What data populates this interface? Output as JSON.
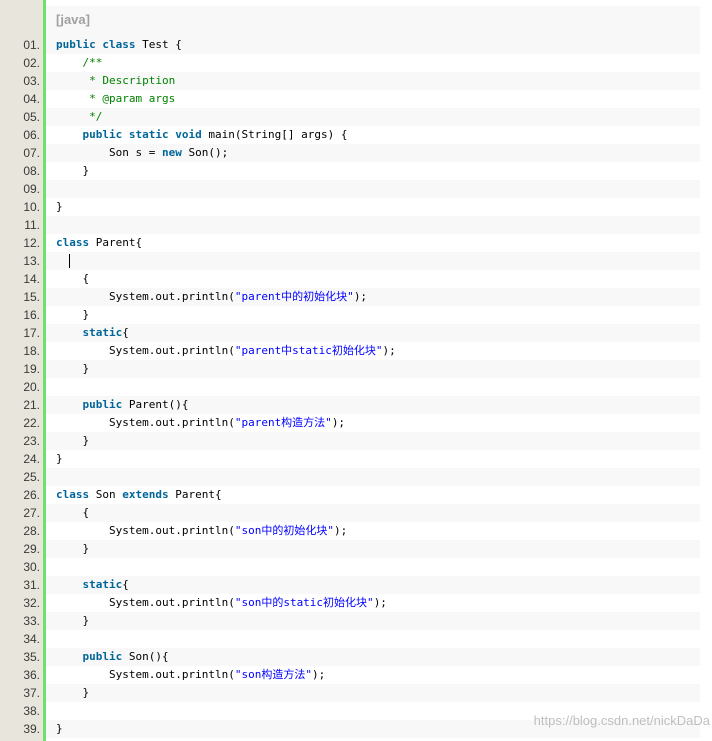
{
  "header": {
    "language_label": "[java]"
  },
  "watermark": "https://blog.csdn.net/nickDaDa",
  "colors": {
    "gutter": "#e8e5dc",
    "accent_bar": "#6ce26c",
    "keyword": "#006699",
    "comment": "#008200",
    "string": "#0000ff"
  },
  "lines": [
    {
      "n": "01.",
      "indent": "",
      "tokens": [
        [
          "kw",
          "public"
        ],
        [
          "t",
          " "
        ],
        [
          "kw",
          "class"
        ],
        [
          "t",
          " Test {"
        ]
      ]
    },
    {
      "n": "02.",
      "indent": "    ",
      "tokens": [
        [
          "cm",
          "/**"
        ]
      ]
    },
    {
      "n": "03.",
      "indent": "     ",
      "tokens": [
        [
          "cm",
          "* Description"
        ]
      ]
    },
    {
      "n": "04.",
      "indent": "     ",
      "tokens": [
        [
          "cm",
          "* @param args"
        ]
      ]
    },
    {
      "n": "05.",
      "indent": "     ",
      "tokens": [
        [
          "cm",
          "*/"
        ]
      ]
    },
    {
      "n": "06.",
      "indent": "    ",
      "tokens": [
        [
          "kw",
          "public"
        ],
        [
          "t",
          " "
        ],
        [
          "kw",
          "static"
        ],
        [
          "t",
          " "
        ],
        [
          "kw",
          "void"
        ],
        [
          "t",
          " main(String[] args) {"
        ]
      ]
    },
    {
      "n": "07.",
      "indent": "        ",
      "tokens": [
        [
          "t",
          "Son s = "
        ],
        [
          "kw",
          "new"
        ],
        [
          "t",
          " Son();"
        ]
      ]
    },
    {
      "n": "08.",
      "indent": "    ",
      "tokens": [
        [
          "t",
          "}"
        ]
      ]
    },
    {
      "n": "09.",
      "indent": "",
      "tokens": []
    },
    {
      "n": "10.",
      "indent": "",
      "tokens": [
        [
          "t",
          "}"
        ]
      ]
    },
    {
      "n": "11.",
      "indent": "",
      "tokens": []
    },
    {
      "n": "12.",
      "indent": "",
      "tokens": [
        [
          "kw",
          "class"
        ],
        [
          "t",
          " Parent{"
        ]
      ]
    },
    {
      "n": "13.",
      "indent": "  ",
      "tokens": [
        [
          "caret",
          ""
        ]
      ]
    },
    {
      "n": "14.",
      "indent": "    ",
      "tokens": [
        [
          "t",
          "{"
        ]
      ]
    },
    {
      "n": "15.",
      "indent": "        ",
      "tokens": [
        [
          "t",
          "System.out.println("
        ],
        [
          "st",
          "\"parent中的初始化块\""
        ],
        [
          "t",
          ");"
        ]
      ]
    },
    {
      "n": "16.",
      "indent": "    ",
      "tokens": [
        [
          "t",
          "}"
        ]
      ]
    },
    {
      "n": "17.",
      "indent": "    ",
      "tokens": [
        [
          "kw",
          "static"
        ],
        [
          "t",
          "{"
        ]
      ]
    },
    {
      "n": "18.",
      "indent": "        ",
      "tokens": [
        [
          "t",
          "System.out.println("
        ],
        [
          "st",
          "\"parent中static初始化块\""
        ],
        [
          "t",
          ");"
        ]
      ]
    },
    {
      "n": "19.",
      "indent": "    ",
      "tokens": [
        [
          "t",
          "}"
        ]
      ]
    },
    {
      "n": "20.",
      "indent": "",
      "tokens": []
    },
    {
      "n": "21.",
      "indent": "    ",
      "tokens": [
        [
          "kw",
          "public"
        ],
        [
          "t",
          " Parent(){"
        ]
      ]
    },
    {
      "n": "22.",
      "indent": "        ",
      "tokens": [
        [
          "t",
          "System.out.println("
        ],
        [
          "st",
          "\"parent构造方法\""
        ],
        [
          "t",
          ");"
        ]
      ]
    },
    {
      "n": "23.",
      "indent": "    ",
      "tokens": [
        [
          "t",
          "}"
        ]
      ]
    },
    {
      "n": "24.",
      "indent": "",
      "tokens": [
        [
          "t",
          "}"
        ]
      ]
    },
    {
      "n": "25.",
      "indent": "",
      "tokens": []
    },
    {
      "n": "26.",
      "indent": "",
      "tokens": [
        [
          "kw",
          "class"
        ],
        [
          "t",
          " Son "
        ],
        [
          "kw",
          "extends"
        ],
        [
          "t",
          " Parent{"
        ]
      ]
    },
    {
      "n": "27.",
      "indent": "    ",
      "tokens": [
        [
          "t",
          "{"
        ]
      ]
    },
    {
      "n": "28.",
      "indent": "        ",
      "tokens": [
        [
          "t",
          "System.out.println("
        ],
        [
          "st",
          "\"son中的初始化块\""
        ],
        [
          "t",
          ");"
        ]
      ]
    },
    {
      "n": "29.",
      "indent": "    ",
      "tokens": [
        [
          "t",
          "}"
        ]
      ]
    },
    {
      "n": "30.",
      "indent": "",
      "tokens": []
    },
    {
      "n": "31.",
      "indent": "    ",
      "tokens": [
        [
          "kw",
          "static"
        ],
        [
          "t",
          "{"
        ]
      ]
    },
    {
      "n": "32.",
      "indent": "        ",
      "tokens": [
        [
          "t",
          "System.out.println("
        ],
        [
          "st",
          "\"son中的static初始化块\""
        ],
        [
          "t",
          ");"
        ]
      ]
    },
    {
      "n": "33.",
      "indent": "    ",
      "tokens": [
        [
          "t",
          "}"
        ]
      ]
    },
    {
      "n": "34.",
      "indent": "",
      "tokens": []
    },
    {
      "n": "35.",
      "indent": "    ",
      "tokens": [
        [
          "kw",
          "public"
        ],
        [
          "t",
          " Son(){"
        ]
      ]
    },
    {
      "n": "36.",
      "indent": "        ",
      "tokens": [
        [
          "t",
          "System.out.println("
        ],
        [
          "st",
          "\"son构造方法\""
        ],
        [
          "t",
          ");"
        ]
      ]
    },
    {
      "n": "37.",
      "indent": "    ",
      "tokens": [
        [
          "t",
          "}"
        ]
      ]
    },
    {
      "n": "38.",
      "indent": "",
      "tokens": []
    },
    {
      "n": "39.",
      "indent": "",
      "tokens": [
        [
          "t",
          "}"
        ]
      ]
    }
  ]
}
